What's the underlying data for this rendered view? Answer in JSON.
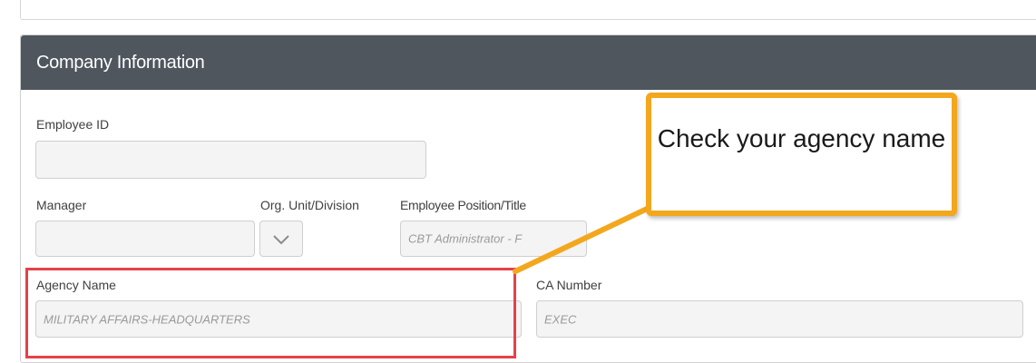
{
  "panel": {
    "title": "Company Information"
  },
  "fields": {
    "employee_id": {
      "label": "Employee ID",
      "value": ""
    },
    "manager": {
      "label": "Manager",
      "value": ""
    },
    "org_unit": {
      "label": "Org. Unit/Division",
      "value": ""
    },
    "position_title": {
      "label": "Employee Position/Title",
      "value": "CBT Administrator - F"
    },
    "agency_name": {
      "label": "Agency Name",
      "value": "MILITARY AFFAIRS-HEADQUARTERS"
    },
    "ca_number": {
      "label": "CA Number",
      "value": "EXEC"
    }
  },
  "callout": {
    "text": "Check your agency name"
  },
  "colors": {
    "header_bg": "#4f565d",
    "highlight": "#e5414b",
    "callout_border": "#f3a71d"
  },
  "icons": {
    "org_unit_select": "chevron-down-icon"
  }
}
